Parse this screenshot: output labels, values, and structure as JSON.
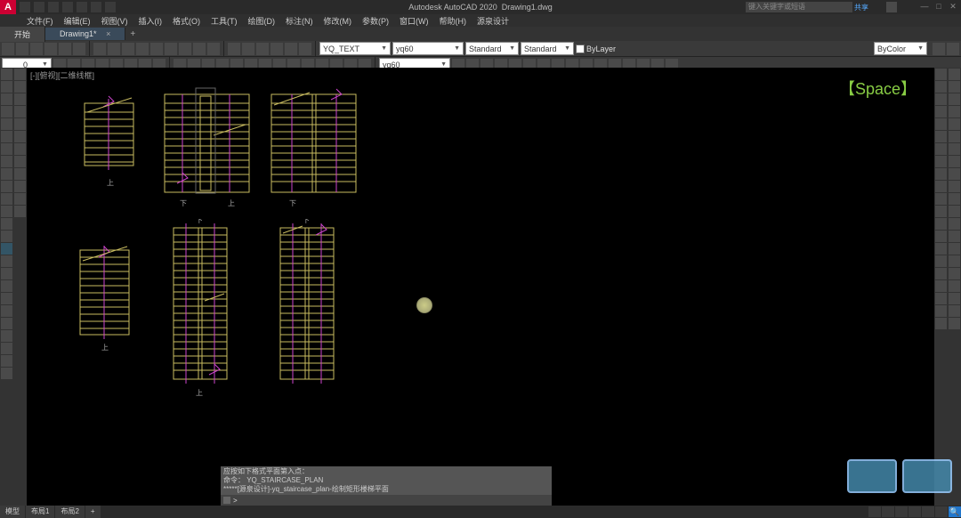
{
  "title": {
    "app": "Autodesk AutoCAD 2020",
    "doc": "Drawing1.dwg"
  },
  "search_placeholder": "键入关键字或短语",
  "share": "共享",
  "menus": [
    "文件(F)",
    "编辑(E)",
    "视图(V)",
    "插入(I)",
    "格式(O)",
    "工具(T)",
    "绘图(D)",
    "标注(N)",
    "修改(M)",
    "参数(P)",
    "窗口(W)",
    "帮助(H)",
    "源泉设计"
  ],
  "tabs": {
    "start": "开始",
    "active": "Drawing1*",
    "add": "+"
  },
  "props": {
    "textstyle": "YQ_TEXT",
    "dimstyle": "yq60",
    "tablestyle": "Standard",
    "mlstyle": "Standard",
    "bylayer_chk": "ByLayer",
    "dimstyle2": "yq60",
    "bycolor": "ByColor"
  },
  "viewport": "[-][俯视][二维线框]",
  "hint": "【Space】",
  "labels": {
    "up": "上",
    "down": "下"
  },
  "cmd": {
    "hist1": "应按如下格式平面第入点：",
    "hist2": "命令：  YQ_STAIRCASE_PLAN",
    "hist3": "*****[源泉设计]-yq_staircase_plan-绘制矩形楼梯平面",
    "prompt": ">"
  },
  "status": {
    "model": "模型",
    "layout1": "布局1",
    "layout2": "布局2"
  },
  "winbtns": {
    "min": "—",
    "max": "□",
    "close": "✕"
  },
  "logo": "A"
}
